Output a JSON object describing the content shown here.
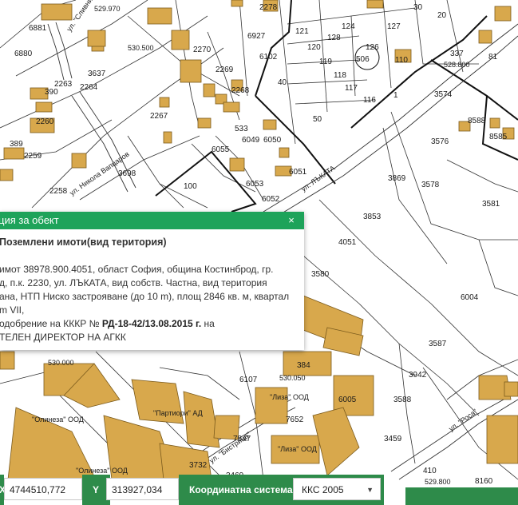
{
  "map": {
    "plot_labels": [
      "6881",
      "6880",
      "2263",
      "2264",
      "2260",
      "2259",
      "2258",
      "3637",
      "2267",
      "2270",
      "2269",
      "2268",
      "6927",
      "6102",
      "2278",
      "40",
      "121",
      "120",
      "119",
      "118",
      "117",
      "116",
      "124",
      "128",
      "127",
      "126",
      "110",
      "81",
      "30",
      "20",
      "3574",
      "3576",
      "8588",
      "8585",
      "3869",
      "3578",
      "3581",
      "3853",
      "4051",
      "3580",
      "6004",
      "3587",
      "3942",
      "3588",
      "3459",
      "8160",
      "6055",
      "6053",
      "6052",
      "6051",
      "6049",
      "6050",
      "3698",
      "100",
      "50",
      "7652",
      "7847",
      "3732",
      "6107",
      "6005",
      "3469",
      "533",
      "337",
      "384",
      "410",
      "389",
      "390",
      "1"
    ],
    "highlight_labels": [
      "506"
    ],
    "scale_labels": [
      "528.800",
      "529.800",
      "530.000",
      "530.050",
      "529.970",
      "530.500"
    ],
    "street_labels": [
      "ул. ЛЪКАТА",
      "ул. \"Роса\"",
      "ул. \"Сливница\"",
      "ул. Никола Вапцаров",
      "ул. \"Бистрица\""
    ],
    "company_labels": [
      "\"Олинеза\" ООД",
      "\"Олинеза\" ООД",
      "\"Партиори\" АД",
      "\"Лиза\" ООД",
      "\"Лиза\" ООД"
    ]
  },
  "popup": {
    "title": "ция за обект",
    "close": "×",
    "subtitle": "Поземлени имоти(вид територия)",
    "line1": "имот 38978.900.4051, област София, община Костинброд, гр.",
    "line2": "д, п.к. 2230, ул. ЛЪКАТА, вид собств. Частна, вид територия",
    "line3": "ана, НТП Ниско застрояване (до 10 m), площ 2846 кв. м, квартал",
    "line4": "m VII,",
    "line5_pre": "одобрение на КККР №",
    "line5_bold": "РД-18-42/13.08.2015 г.",
    "line5_post": "на",
    "line6": "ТЕЛЕН ДИРЕКТОР НА АГКК"
  },
  "coordbar": {
    "x_label": "X",
    "x_value": "4744510,772",
    "y_label": "Y",
    "y_value": "313927,034",
    "system_label": "Координатна система",
    "system_value": "ККС 2005",
    "caret": "▼"
  },
  "colors": {
    "building": "#d8a84c",
    "building_stroke": "#7a5a1c",
    "popup_header": "#1ea35a",
    "coordbar": "#2e8b4a"
  }
}
